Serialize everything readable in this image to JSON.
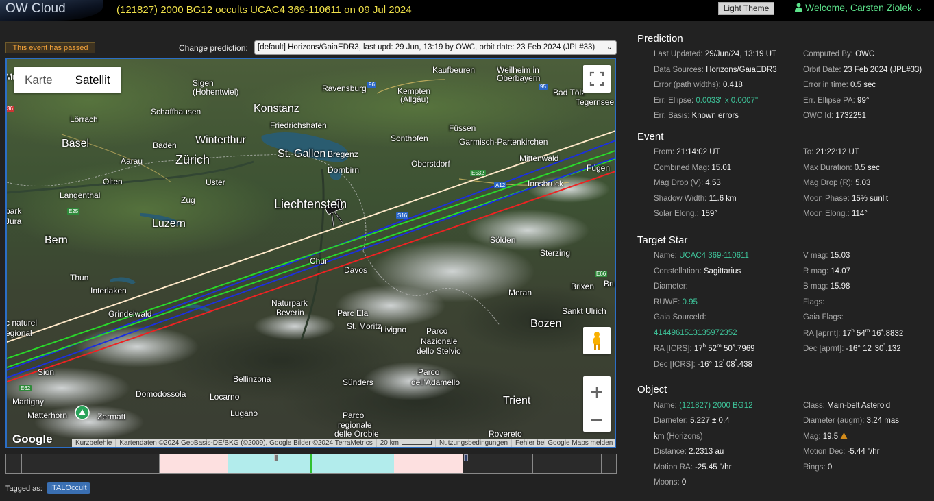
{
  "app": {
    "logo": "OW Cloud",
    "event_title": "(121827) 2000 BG12 occults UCAC4 369-110611 on 09 Jul 2024",
    "theme_button": "Light Theme",
    "welcome": "Welcome, Carsten Ziolek",
    "welcome_caret": "⌄"
  },
  "toolbar": {
    "passed_badge": "This event has passed",
    "change_label": "Change prediction:",
    "prediction_selected": "[default] Horizons/GaiaEDR3, last upd: 29 Jun, 13:19 by OWC, orbit date: 23 Feb 2024 (JPL#33)",
    "caret": "⌄"
  },
  "map": {
    "type_map": "Karte",
    "type_satellite": "Satellit",
    "google": "Google",
    "attribution": [
      "Kurzbefehle",
      "Kartendaten ©2024 GeoBasis-DE/BKG (©2009), Google Bilder ©2024 TerraMetrics",
      "20 km",
      "Nutzungsbedingungen",
      "Fehler bei Google Maps melden"
    ],
    "labels": {
      "mannheim_frag": "Mulhausen",
      "ravensburg": "Ravensburg",
      "kaufbeuren": "Kaufbeuren",
      "weilheim": "Weilheim in",
      "oberbayern": "Oberbayern",
      "sigen": "Sigen",
      "hohentwiel": "(Hohentwiel)",
      "kempten": "Kempten",
      "allgau": "(Allgäu)",
      "badtoelz": "Bad Tölz",
      "schaffhausen": "Schaffhausen",
      "konstanz": "Konstanz",
      "tegernsee": "Tegernsee",
      "lorrach": "Lörrach",
      "friedrichshafen": "Friedrichshafen",
      "fussen": "Füssen",
      "basel": "Basel",
      "baden": "Baden",
      "winterthur": "Winterthur",
      "sonthofen": "Sonthofen",
      "garmisch": "Garmisch-Partenkirchen",
      "aarau": "Aarau",
      "zurich": "Zürich",
      "stgallen": "St. Gallen",
      "bregenz": "Bregenz",
      "dornbirn": "Dornbirn",
      "oberstdorf": "Oberstdorf",
      "mittenwald": "Mittenwald",
      "olten": "Olten",
      "uster": "Uster",
      "innsbruck": "Innsbruck",
      "fuegen": "Fügen",
      "liechtenstein": "Liechtenstein",
      "zug": "Zug",
      "langenthal": "Langenthal",
      "park": "park",
      "jura": "Jura",
      "luzern": "Luzern",
      "bern": "Bern",
      "solden": "Sölden",
      "chur": "Chur",
      "sterzing": "Sterzing",
      "davos": "Davos",
      "thun": "Thun",
      "interlaken": "Interlaken",
      "brixen": "Brixen",
      "bru": "Bru",
      "naturpark": "Naturpark",
      "beverin": "Beverin",
      "parcela": "Parc Ela",
      "meran": "Meran",
      "grindelwald": "Grindelwald",
      "sankt_ulrich": "Sankt Ulrich",
      "stmoritz": "St. Moritz",
      "livigno": "Livigno",
      "bozen": "Bozen",
      "parco1": "Parco",
      "nazionale": "Nazionale",
      "stelvio": "dello Stelvio",
      "naturel": "c naturel",
      "regional": "égional",
      "sion": "Sion",
      "parco2": "Parco",
      "adamello": "dell'Adamello",
      "bellinzona": "Bellinzona",
      "sunders": "Sünders",
      "martigny": "Martigny",
      "domodossola": "Domodossola",
      "locarno": "Locarno",
      "trient": "Trient",
      "matterhorn": "Matterhorn",
      "zermatt": "Zermatt",
      "lugano": "Lugano",
      "parco3": "Parco",
      "regionale": "regionale",
      "orobie": "delle Orobie",
      "rovereto": "Rovereto",
      "e62": "E62",
      "e25": "E25",
      "e532": "E532",
      "a12": "A12",
      "s16": "S16",
      "e66": "E66",
      "r96": "96",
      "r95": "95",
      "r36": "36"
    }
  },
  "tags": {
    "label": "Tagged as:",
    "chip": "ITALOccult"
  },
  "prediction": {
    "title": "Prediction",
    "last_updated_label": "Last Updated:",
    "last_updated": "29/Jun/24, 13:19 UT",
    "computed_by_label": "Computed By:",
    "computed_by": "OWC",
    "data_sources_label": "Data Sources:",
    "data_sources": "Horizons/GaiaEDR3",
    "orbit_date_label": "Orbit Date:",
    "orbit_date": "23 Feb 2024 (JPL#33)",
    "error_label": "Error (path widths):",
    "error": "0.418",
    "error_time_label": "Error in time:",
    "error_time": "0.5 sec",
    "err_ellipse_label": "Err. Ellipse:",
    "err_ellipse": "0.0033\" x 0.0007\"",
    "err_ellipse_pa_label": "Err. Ellipse PA:",
    "err_ellipse_pa": "99°",
    "err_basis_label": "Err. Basis:",
    "err_basis": "Known errors",
    "owc_id_label": "OWC Id:",
    "owc_id": "1732251"
  },
  "event": {
    "title": "Event",
    "from_label": "From:",
    "from": "21:14:02 UT",
    "to_label": "To:",
    "to": "21:22:12 UT",
    "combined_mag_label": "Combined Mag:",
    "combined_mag": "15.01",
    "max_duration_label": "Max Duration:",
    "max_duration": "0.5 sec",
    "mag_drop_v_label": "Mag Drop (V):",
    "mag_drop_v": "4.53",
    "mag_drop_r_label": "Mag Drop (R):",
    "mag_drop_r": "5.03",
    "shadow_width_label": "Shadow Width:",
    "shadow_width": "11.6 km",
    "moon_phase_label": "Moon Phase:",
    "moon_phase": "15% sunlit",
    "solar_elong_label": "Solar Elong.:",
    "solar_elong": "159°",
    "moon_elong_label": "Moon Elong.:",
    "moon_elong": "114°"
  },
  "star": {
    "title": "Target Star",
    "name_label": "Name:",
    "name": "UCAC4 369-110611",
    "vmag_label": "V mag:",
    "vmag": "15.03",
    "constellation_label": "Constellation:",
    "constellation": "Sagittarius",
    "rmag_label": "R mag:",
    "rmag": "14.07",
    "diameter_label": "Diameter:",
    "bmag_label": "B mag:",
    "bmag": "15.98",
    "ruwe_label": "RUWE:",
    "ruwe": "0.95",
    "flags_label": "Flags:",
    "gaia_source_label": "Gaia SourceId:",
    "gaia_flags_label": "Gaia Flags:",
    "gaia_source": "4144961513135972352",
    "ra_aprnt_label": "RA [aprnt]:",
    "ra_aprnt": {
      "h": "17",
      "m": "54",
      "s": "16",
      "frac": ".8832"
    },
    "ra_icrs_label": "RA [ICRS]:",
    "ra_icrs": {
      "h": "17",
      "m": "52",
      "s": "50",
      "frac": ".7969"
    },
    "dec_aprnt_label": "Dec [aprnt]:",
    "dec_aprnt": {
      "d": "-16° 12",
      "m": "'",
      "s": " 30",
      "frac": ".132"
    },
    "dec_icrs_label": "Dec [ICRS]:",
    "dec_icrs": {
      "d": "-16° 12",
      "m": "'",
      "s": " 08",
      "frac": ".438"
    },
    "unit_h": "h",
    "unit_m": "m",
    "unit_s": "s",
    "unit_dq": "\""
  },
  "object": {
    "title": "Object",
    "name_label": "Name:",
    "name": "(121827) 2000 BG12",
    "class_label": "Class:",
    "class": "Main-belt Asteroid",
    "diameter_label": "Diameter:",
    "diameter": "5.227 ± 0.4",
    "diameter_augm_label": "Diameter (augm):",
    "diameter_augm": "3.24 mas",
    "diameter_unit": "km",
    "diameter_source": "(Horizons)",
    "mag_label": "Mag:",
    "mag": "19.5",
    "distance_label": "Distance:",
    "distance": "2.2313 au",
    "motion_dec_label": "Motion Dec:",
    "motion_dec": "-5.44 \"/hr",
    "motion_ra_label": "Motion RA:",
    "motion_ra": "-25.45 \"/hr",
    "rings_label": "Rings:",
    "rings": "0",
    "moons_label": "Moons:",
    "moons": "0"
  },
  "colors": {
    "title_yellow": "#f0e14a",
    "welcome_green": "#5ce28a",
    "link_green": "#3ec49a",
    "path_center": "#ffe9c9",
    "path_blue": "#1b2fe0",
    "path_green": "#2ad92a",
    "path_red": "#ee2222",
    "timeline_pink": "#fde0e0",
    "timeline_cyan": "#b2ecec",
    "timeline_marker": "#30c030",
    "badge_orange": "#f2a23a",
    "tag_blue": "#3a6fb2"
  }
}
